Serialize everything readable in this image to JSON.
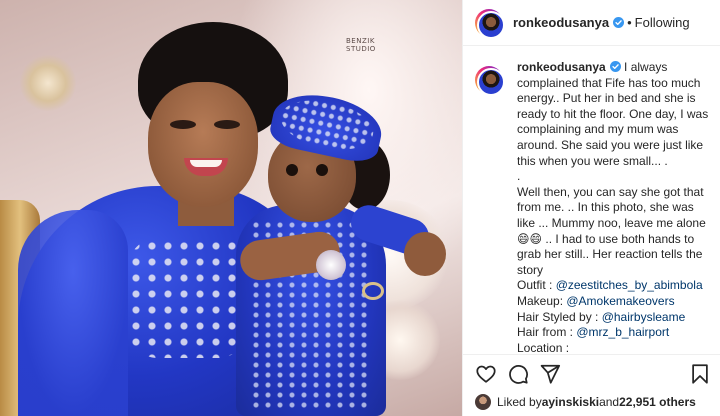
{
  "post": {
    "photo": {
      "watermark": "BENZIK\nSTUDIO"
    },
    "header": {
      "username": "ronkeodusanya",
      "separator": "•",
      "follow_state": "Following"
    },
    "caption": {
      "username": "ronkeodusanya",
      "paragraph_1": "I always complained that Fife has too much energy.. Put her in bed and she is ready to hit the floor. One day, I was complaining and my mum was around. She said you were just like this when you were small... .",
      "paragraph_dot": ".",
      "paragraph_2": "Well then, you can say she got that from me. .. In this photo, she was like ... Mummy noo, leave me alone 😄😄 .. I had to use both hands to grab her still.. Her reaction tells the story",
      "credits": [
        {
          "label": "Outfit : ",
          "value": "@zeestitches_by_abimbola"
        },
        {
          "label": "Makeup: ",
          "value": "@Amokemakeovers"
        },
        {
          "label": "Hair Styled by : ",
          "value": "@hairbysleame"
        },
        {
          "label": "Hair from : ",
          "value": "@mrz_b_hairport"
        },
        {
          "label": "Location : ",
          "value": ""
        }
      ]
    },
    "actions": {
      "like_icon": "heart-icon",
      "comment_icon": "comment-icon",
      "share_icon": "paper-plane-icon",
      "save_icon": "bookmark-icon"
    },
    "likes": {
      "prefix": "Liked by ",
      "first_liker": "ayinskiski",
      "middle": " and ",
      "others": "22,951 others"
    },
    "colors": {
      "verified": "#3897f0",
      "link": "#00376b",
      "text": "#262626",
      "divider": "#efefef"
    }
  }
}
